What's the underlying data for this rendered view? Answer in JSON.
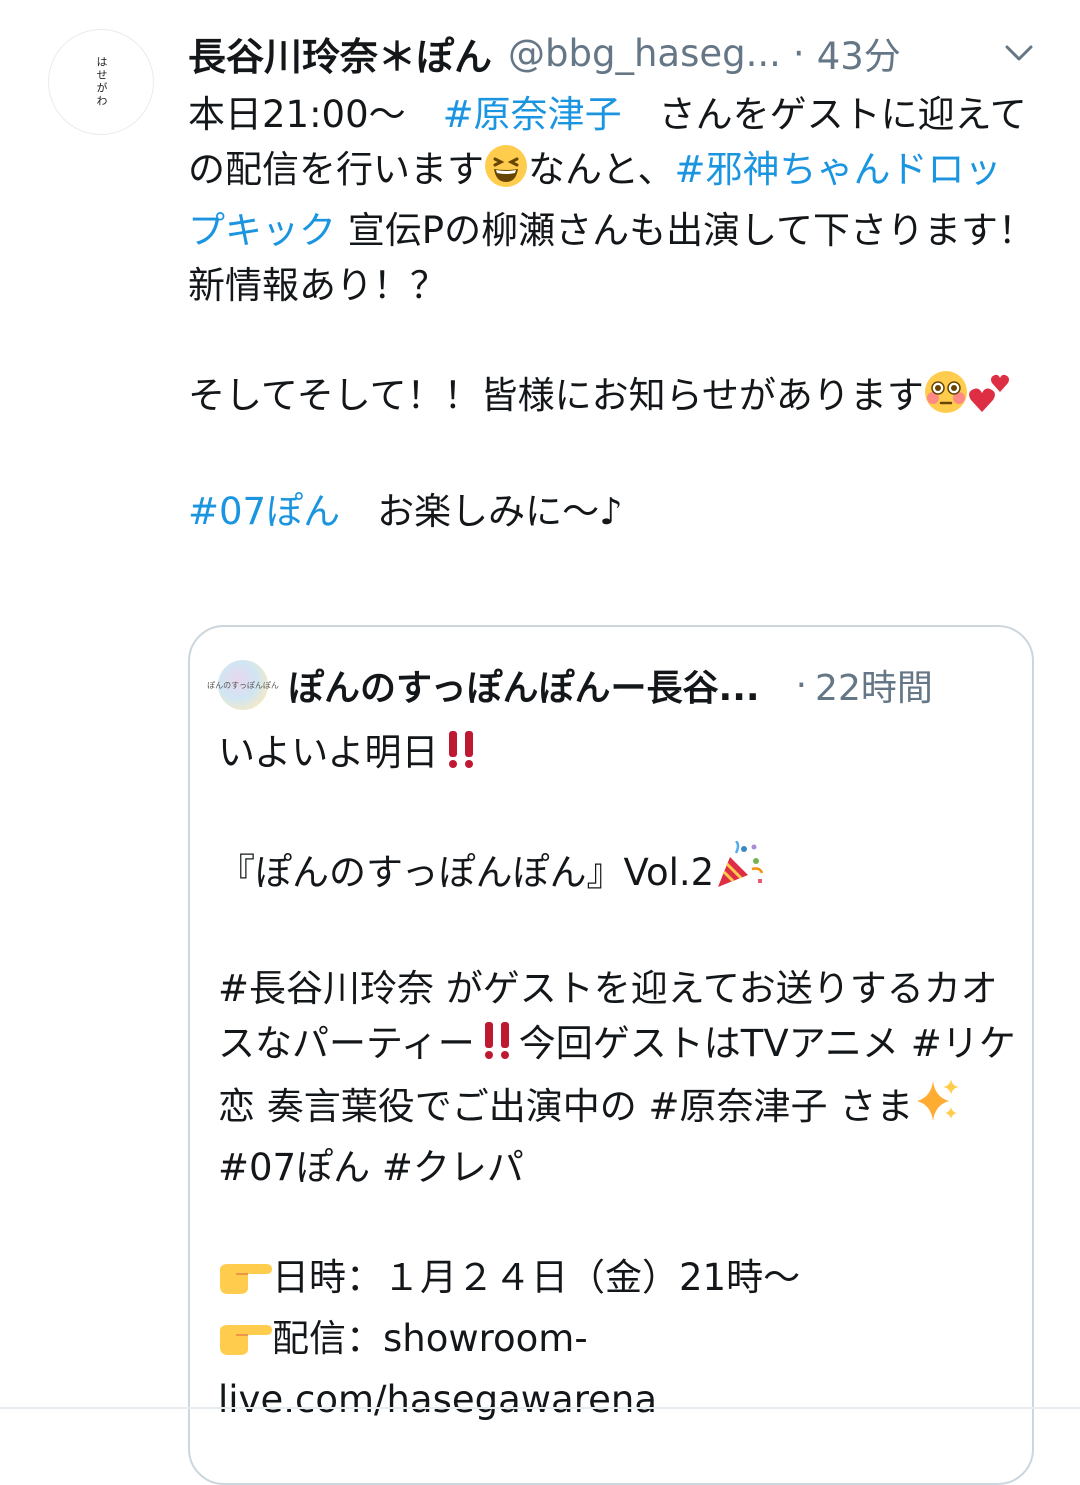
{
  "tweet": {
    "avatar_text": "はせがわ",
    "display_name": "長谷川玲奈＊ぽん",
    "handle": "@bbg_haseg...",
    "separator": "·",
    "time": "43分",
    "menu_icon": "chevron-down-icon",
    "line1_a": "本日21:00〜　",
    "line1_tag": "#原奈津子",
    "line1_b": "　さんをゲストに迎えての配信を行います",
    "line1_c": "なんと、",
    "line1_tag2": "#邪神ちゃんドロップキック",
    "line1_d": " 宣伝Pの柳瀬さんも出演して下さります！新情報あり！？",
    "line2": "そしてそして！！皆様にお知らせがあります",
    "line3_tag": "#07ぽん",
    "line3_b": "　お楽しみに〜♪",
    "emoji_grin": "grinning-squinting-face-icon",
    "emoji_flushed": "flushed-face-icon",
    "emoji_hearts": "two-hearts-icon"
  },
  "quote": {
    "avatar_text": "ぽんのすっぽんぽん",
    "display_name": "ぽんのすっぽんぽんー長谷...",
    "separator": "·",
    "time": "22時間",
    "line1": "いよいよ明日",
    "line2": "『ぽんのすっぽんぽん』Vol.2",
    "line3_a": "#長谷川玲奈 がゲストを迎えてお送りするカオスなパーティー",
    "line3_b": "今回ゲストはTVアニメ #リケ恋 奏言葉役でご出演中の #原奈津子 さま",
    "line3_c": " #07ぽん #クレパ",
    "line4": "日時：１月２４日（金）21時〜",
    "line5": "配信：showroom-live.com/hasegawarena",
    "emoji_bang": "double-exclamation-icon",
    "emoji_party": "party-popper-icon",
    "emoji_sparkles": "sparkles-icon",
    "emoji_point": "pointing-right-icon"
  },
  "colors": {
    "hashtag": "#1b95e0",
    "text": "#14171a",
    "muted": "#657786",
    "border": "#ccd6dd"
  }
}
